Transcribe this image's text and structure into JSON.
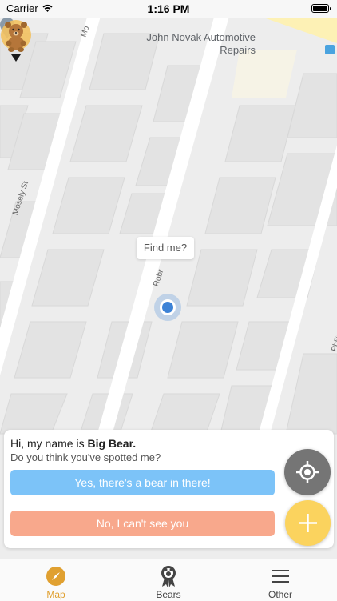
{
  "status_bar": {
    "carrier": "Carrier",
    "time": "1:16 PM"
  },
  "map": {
    "poi": {
      "name": "John Novak Automotive Repairs"
    },
    "streets": {
      "mosely": "Mosely St",
      "mo": "Mo",
      "philip": "Philip",
      "robr": "Robr"
    },
    "tooltip": "Find me?"
  },
  "card": {
    "greeting_prefix": "Hi, my name is ",
    "bear_name": "Big Bear.",
    "question": "Do you think you've spotted me?",
    "yes_label": "Yes, there's a bear in there!",
    "no_label": "No, I can't see you"
  },
  "fabs": {
    "locate_icon": "crosshair-icon",
    "add_icon": "plus-icon"
  },
  "tabs": [
    {
      "label": "Map",
      "icon": "compass-icon",
      "active": true
    },
    {
      "label": "Bears",
      "icon": "bear-award-icon",
      "active": false
    },
    {
      "label": "Other",
      "icon": "menu-icon",
      "active": false
    }
  ],
  "colors": {
    "accent": "#e0a030",
    "yes_button": "#7cc3f8",
    "no_button": "#f8a88c",
    "add_fab": "#fbd35e",
    "locate_fab": "#757575"
  }
}
